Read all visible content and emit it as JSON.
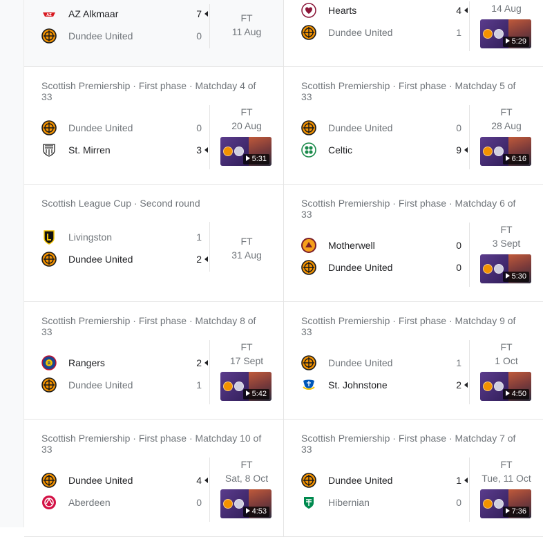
{
  "colors": {
    "primary_text": "#202124",
    "secondary_text": "#70757a",
    "divider": "#e4e4e4",
    "highlight_bg": "#f8f9fa",
    "thumbnail_purple": "#3b2566",
    "dundee_orange": "#f39200"
  },
  "matches": [
    {
      "competition": "",
      "status": "FT",
      "date": "11 Aug",
      "home": {
        "name": "AZ Alkmaar",
        "score": "7",
        "logo": "az-alkmaar-crest-icon",
        "winner": true
      },
      "away": {
        "name": "Dundee United",
        "score": "0",
        "logo": "dundee-united-crest-icon",
        "winner": false
      },
      "highlight": ""
    },
    {
      "competition": "",
      "status": "",
      "date": "14 Aug",
      "home": {
        "name": "Hearts",
        "score": "4",
        "logo": "hearts-crest-icon",
        "winner": true
      },
      "away": {
        "name": "Dundee United",
        "score": "1",
        "logo": "dundee-united-crest-icon",
        "winner": false
      },
      "highlight": "5:29"
    },
    {
      "competition": "Scottish Premiership · First phase · Matchday 4 of 33",
      "status": "FT",
      "date": "20 Aug",
      "home": {
        "name": "Dundee United",
        "score": "0",
        "logo": "dundee-united-crest-icon",
        "winner": false
      },
      "away": {
        "name": "St. Mirren",
        "score": "3",
        "logo": "st-mirren-crest-icon",
        "winner": true
      },
      "highlight": "5:31"
    },
    {
      "competition": "Scottish Premiership · First phase · Matchday 5 of 33",
      "status": "FT",
      "date": "28 Aug",
      "home": {
        "name": "Dundee United",
        "score": "0",
        "logo": "dundee-united-crest-icon",
        "winner": false
      },
      "away": {
        "name": "Celtic",
        "score": "9",
        "logo": "celtic-crest-icon",
        "winner": true
      },
      "highlight": "6:16"
    },
    {
      "competition": "Scottish League Cup · Second round",
      "status": "FT",
      "date": "31 Aug",
      "home": {
        "name": "Livingston",
        "score": "1",
        "logo": "livingston-crest-icon",
        "winner": false
      },
      "away": {
        "name": "Dundee United",
        "score": "2",
        "logo": "dundee-united-crest-icon",
        "winner": true
      },
      "highlight": ""
    },
    {
      "competition": "Scottish Premiership · First phase · Matchday 6 of 33",
      "status": "FT",
      "date": "3 Sept",
      "home": {
        "name": "Motherwell",
        "score": "0",
        "logo": "motherwell-crest-icon",
        "winner": null
      },
      "away": {
        "name": "Dundee United",
        "score": "0",
        "logo": "dundee-united-crest-icon",
        "winner": null
      },
      "highlight": "5:30"
    },
    {
      "competition": "Scottish Premiership · First phase · Matchday 8 of 33",
      "status": "FT",
      "date": "17 Sept",
      "home": {
        "name": "Rangers",
        "score": "2",
        "logo": "rangers-crest-icon",
        "winner": true
      },
      "away": {
        "name": "Dundee United",
        "score": "1",
        "logo": "dundee-united-crest-icon",
        "winner": false
      },
      "highlight": "5:42"
    },
    {
      "competition": "Scottish Premiership · First phase · Matchday 9 of 33",
      "status": "FT",
      "date": "1 Oct",
      "home": {
        "name": "Dundee United",
        "score": "1",
        "logo": "dundee-united-crest-icon",
        "winner": false
      },
      "away": {
        "name": "St. Johnstone",
        "score": "2",
        "logo": "st-johnstone-crest-icon",
        "winner": true
      },
      "highlight": "4:50"
    },
    {
      "competition": "Scottish Premiership · First phase · Matchday 10 of 33",
      "status": "FT",
      "date": "Sat, 8 Oct",
      "home": {
        "name": "Dundee United",
        "score": "4",
        "logo": "dundee-united-crest-icon",
        "winner": true
      },
      "away": {
        "name": "Aberdeen",
        "score": "0",
        "logo": "aberdeen-crest-icon",
        "winner": false
      },
      "highlight": "4:53"
    },
    {
      "competition": "Scottish Premiership · First phase · Matchday 7 of 33",
      "status": "FT",
      "date": "Tue, 11 Oct",
      "home": {
        "name": "Dundee United",
        "score": "1",
        "logo": "dundee-united-crest-icon",
        "winner": true
      },
      "away": {
        "name": "Hibernian",
        "score": "0",
        "logo": "hibernian-crest-icon",
        "winner": false
      },
      "highlight": "7:36"
    }
  ]
}
